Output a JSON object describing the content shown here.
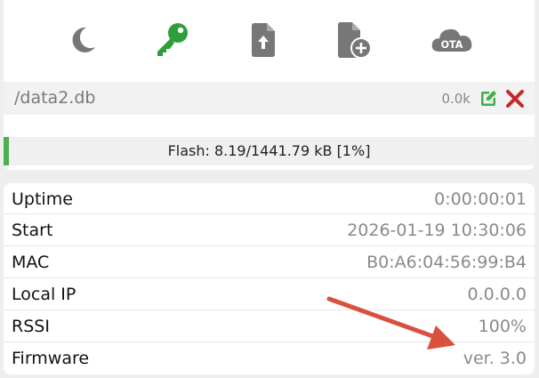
{
  "toolbar": {
    "icons": [
      "moon-icon",
      "key-icon",
      "file-upload-icon",
      "file-add-icon",
      "ota-cloud-icon"
    ],
    "ota_label": "OTA",
    "colors": {
      "default": "#777777",
      "active": "#2e9e3a"
    }
  },
  "file": {
    "name": "/data2.db",
    "size": "0.0k",
    "edit_color": "#3bb04a",
    "delete_color": "#c62828"
  },
  "flash": {
    "text": "Flash: 8.19/1441.79 kB [1%]",
    "percent": 1,
    "bar_color": "#4caf50"
  },
  "info": {
    "rows": [
      {
        "label": "Uptime",
        "value": "0:00:00:01"
      },
      {
        "label": "Start",
        "value": "2026-01-19 10:30:06"
      },
      {
        "label": "MAC",
        "value": "B0:A6:04:56:99:B4"
      },
      {
        "label": "Local IP",
        "value": "0.0.0.0"
      },
      {
        "label": "RSSI",
        "value": "100%"
      },
      {
        "label": "Firmware",
        "value": "ver. 3.0"
      }
    ]
  },
  "annotation": {
    "arrow_color": "#d9503f"
  }
}
